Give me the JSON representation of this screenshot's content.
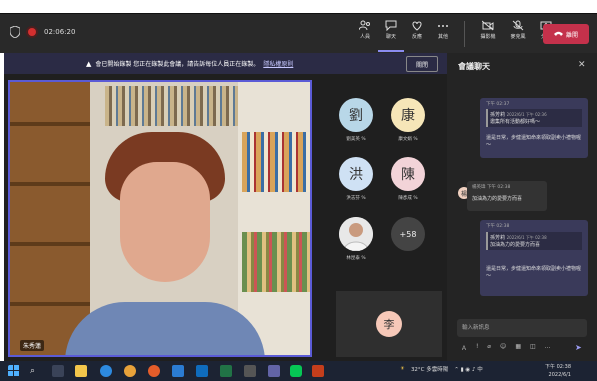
{
  "meeting": {
    "timer": "02:06:20",
    "controls": [
      {
        "icon": "people-icon",
        "label": "人員"
      },
      {
        "icon": "chat-icon",
        "label": "聊天"
      },
      {
        "icon": "react-icon",
        "label": "反應"
      },
      {
        "icon": "more-icon",
        "label": "其他"
      },
      {
        "icon": "camera-icon",
        "label": "攝影機"
      },
      {
        "icon": "mic-icon",
        "label": "麥克風"
      },
      {
        "icon": "share-icon",
        "label": "分享"
      }
    ],
    "leave_label": "離開"
  },
  "banner": {
    "text": "會已開始錄製 您正在錄製此會議，請告訴每位人員正在錄製。",
    "link": "隱私權原則",
    "close": "關閉"
  },
  "main_video": {
    "name_tag": "朱秀蓮"
  },
  "participants": [
    {
      "initial": "劉",
      "name": "劉美英 %"
    },
    {
      "initial": "康",
      "name": "康文娟 %"
    },
    {
      "initial": "洪",
      "name": "洪志芬 %"
    },
    {
      "initial": "陳",
      "name": "陳彥成 %"
    },
    {
      "initial": "",
      "name": "林昆泰 %"
    },
    {
      "initial": "+58",
      "name": ""
    }
  ],
  "bottom_tile": {
    "initial": "李"
  },
  "chat": {
    "title": "會議聊天",
    "messages": [
      {
        "time": "下午 02:37",
        "quote_name": "孫芳莉",
        "quote_time": "2022/6/1 下午 02:36",
        "quote_text": "邀集所有活動都好嗎～",
        "text": "還是日常，步健還知命來領取副卖小禮物喔～"
      },
      {
        "sender": "楊英瑋",
        "time": "下午 02:38",
        "text": "加油為力的愛要方而喜"
      },
      {
        "time": "下午 02:38",
        "quote_name": "孫芳莉",
        "quote_time": "2022/6/1 下午 02:38",
        "quote_text": "加油為力的愛要方而喜",
        "text": "還是日常，步健還知命來領取副卖小禮物喔～"
      }
    ],
    "input_placeholder": "輸入新訊息"
  },
  "taskbar": {
    "weather": "32°C 多雲時陽",
    "time": "下午 02:38",
    "date": "2022/6/1"
  }
}
